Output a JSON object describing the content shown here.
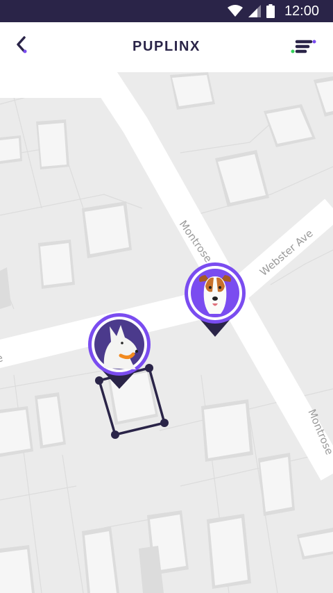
{
  "status_bar": {
    "time": "12:00",
    "icons": [
      "wifi-icon",
      "signal-icon",
      "battery-icon"
    ]
  },
  "app_bar": {
    "title": "PUPLINX",
    "back_icon": "chevron-left-icon",
    "menu_icon": "menu-icon"
  },
  "map": {
    "streets": {
      "montrose_1": "Montrose",
      "webster": "Webster Ave",
      "montrose_2": "Montrose",
      "cross_street_partial": "e"
    },
    "pins": [
      {
        "name": "white-dog-pin",
        "subject": "white-dog-icon"
      },
      {
        "name": "terrier-dog-pin",
        "subject": "terrier-dog-icon"
      }
    ],
    "geofence": {
      "label": "geofence-polygon"
    }
  },
  "colors": {
    "status_bar": "#2a2448",
    "brand_dark": "#2a2448",
    "accent_purple": "#7a4cf0",
    "accent_green": "#35d05a",
    "map_bg": "#ebebeb",
    "road": "#ffffff",
    "building": "#f5f5f5"
  }
}
